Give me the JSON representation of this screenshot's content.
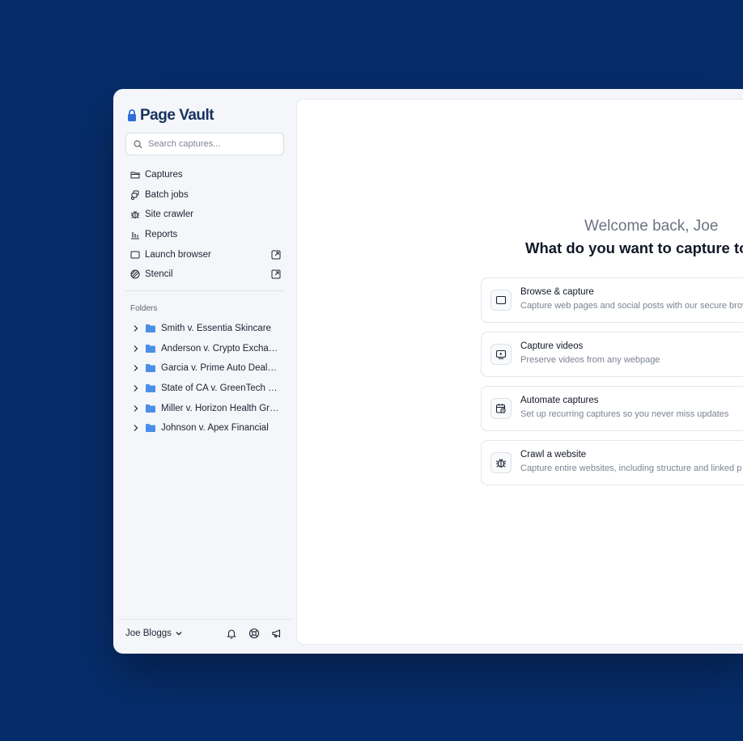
{
  "app": {
    "logo_text": "Page Vault"
  },
  "search": {
    "placeholder": "Search captures..."
  },
  "nav": {
    "items": [
      {
        "label": "Captures",
        "icon": "folder-open-icon"
      },
      {
        "label": "Batch jobs",
        "icon": "batch-icon"
      },
      {
        "label": "Site crawler",
        "icon": "bug-icon"
      },
      {
        "label": "Reports",
        "icon": "bar-chart-icon"
      },
      {
        "label": "Launch browser",
        "icon": "browser-window-icon",
        "external": true
      },
      {
        "label": "Stencil",
        "icon": "stencil-icon",
        "external": true
      }
    ]
  },
  "folders": {
    "heading": "Folders",
    "items": [
      {
        "name": "Smith v. Essentia Skincare"
      },
      {
        "name": "Anderson v. Crypto Exchan..."
      },
      {
        "name": "Garcia v. Prime Auto Dealers"
      },
      {
        "name": "State of CA v. GreenTech So..."
      },
      {
        "name": "Miller v. Horizon Health Gro..."
      },
      {
        "name": "Johnson v. Apex Financial"
      }
    ]
  },
  "user": {
    "name": "Joe Bloggs"
  },
  "main": {
    "welcome": "Welcome back, Joe",
    "question": "What do you want to capture to",
    "cards": [
      {
        "title": "Browse & capture",
        "desc": "Capture web pages and social posts with our secure brov",
        "icon": "browser-window-icon"
      },
      {
        "title": "Capture videos",
        "desc": "Preserve videos from any webpage",
        "icon": "video-icon"
      },
      {
        "title": "Automate captures",
        "desc": "Set up recurring captures so you never miss updates",
        "icon": "calendar-clock-icon"
      },
      {
        "title": "Crawl a website",
        "desc": "Capture entire websites, including structure and linked p",
        "icon": "bug-icon"
      }
    ]
  },
  "colors": {
    "background": "#062d6b",
    "brand": "#17325f",
    "folder_icon": "#4a8fe7",
    "logo_lock": "#2f6fdc"
  }
}
